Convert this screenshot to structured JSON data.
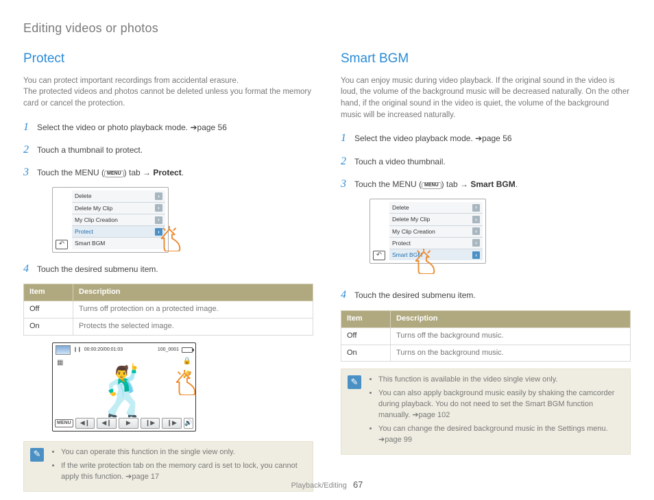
{
  "page_title": "Editing videos or photos",
  "footer": {
    "chapter": "Playback/Editing",
    "page": "67"
  },
  "protect": {
    "heading": "Protect",
    "intro_lines": [
      "You can protect important recordings from accidental erasure.",
      "The protected videos and photos cannot be deleted unless you format the memory card or cancel the protection."
    ],
    "steps": {
      "s1": "Select the video or photo playback mode. ➔page 56",
      "s2": "Touch a thumbnail to protect.",
      "s3_pre": "Touch the MENU (",
      "s3_menu": "MENU",
      "s3_mid": ") tab → ",
      "s3_bold": "Protect",
      "s3_end": ".",
      "s4": "Touch the desired submenu item."
    },
    "menu_items": {
      "m0": "Delete",
      "m1": "Delete My Clip",
      "m2": "My Clip Creation",
      "m3": "Protect",
      "m4": "Smart BGM"
    },
    "table": {
      "h_item": "Item",
      "h_desc": "Description",
      "off_k": "Off",
      "off_v": "Turns off protection on a protected image.",
      "on_k": "On",
      "on_v": "Protects the selected image."
    },
    "playback": {
      "pause": "❙❙",
      "time": "00:00:20/00:01:03",
      "clipname": "100_0001",
      "menu_label": "MENU"
    },
    "notes": {
      "n1": "You can operate this function in the single view only.",
      "n2": "If the write protection tab on the memory card is set to lock, you cannot apply this function. ➔page 17"
    }
  },
  "smartbgm": {
    "heading": "Smart BGM",
    "intro": "You can enjoy music during video playback. If the original sound in the video is loud, the volume of the background music will be decreased naturally. On the other hand, if the original sound in the video is quiet, the volume of the background music will be increased naturally.",
    "steps": {
      "s1": "Select the video playback mode. ➔page 56",
      "s2": "Touch a video thumbnail.",
      "s3_pre": "Touch the MENU (",
      "s3_menu": "MENU",
      "s3_mid": ") tab → ",
      "s3_bold": "Smart BGM",
      "s3_end": ".",
      "s4": "Touch the desired submenu item."
    },
    "menu_items": {
      "m0": "Delete",
      "m1": "Delete My Clip",
      "m2": "My Clip Creation",
      "m3": "Protect",
      "m4": "Smart BGM"
    },
    "table": {
      "h_item": "Item",
      "h_desc": "Description",
      "off_k": "Off",
      "off_v": "Turns off the background music.",
      "on_k": "On",
      "on_v": "Turns on the background music."
    },
    "notes": {
      "n1": "This function is available in the video single view only.",
      "n2": "You can also apply background music easily by shaking the camcorder during playback. You do not need to set the Smart BGM function manually. ➔page 102",
      "n3": "You can change the desired background music in the Settings menu. ➔page 99"
    }
  }
}
